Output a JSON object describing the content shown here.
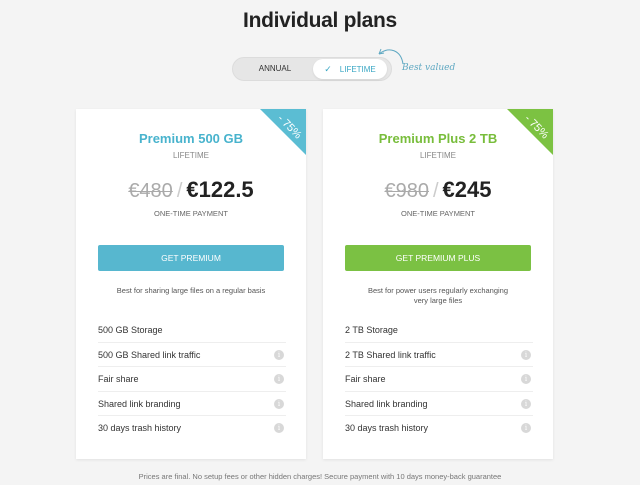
{
  "page": {
    "title": "Individual plans"
  },
  "toggle": {
    "annual_label": "ANNUAL",
    "lifetime_label": "LIFETIME",
    "check_glyph": "✓",
    "best_valued": "Best valued",
    "selected": "LIFETIME"
  },
  "plans": [
    {
      "discount": "- 75%",
      "name": "Premium 500 GB",
      "period": "LIFETIME",
      "old_price": "€480",
      "separator": "/",
      "new_price": "€122.5",
      "price_note": "ONE-TIME PAYMENT",
      "cta": "GET PREMIUM",
      "description": "Best for sharing large files on a regular basis",
      "features": [
        "500 GB Storage",
        "500 GB Shared link traffic",
        "Fair share",
        "Shared link branding",
        "30 days trash history"
      ],
      "accent": "#57b7cf"
    },
    {
      "discount": "- 75%",
      "name": "Premium Plus 2 TB",
      "period": "LIFETIME",
      "old_price": "€980",
      "separator": "/",
      "new_price": "€245",
      "price_note": "ONE-TIME PAYMENT",
      "cta": "GET PREMIUM PLUS",
      "description": "Best for power users regularly exchanging very large files",
      "features": [
        "2 TB Storage",
        "2 TB Shared link traffic",
        "Fair share",
        "Shared link branding",
        "30 days trash history"
      ],
      "accent": "#7bc143"
    }
  ],
  "info_glyph": "i",
  "footer": {
    "note": "Prices are final. No setup fees or other hidden charges! Secure payment with 10 days money-back guarantee"
  },
  "icons": {
    "info": "info-icon",
    "check": "check-icon",
    "arrow": "curved-arrow-icon"
  }
}
